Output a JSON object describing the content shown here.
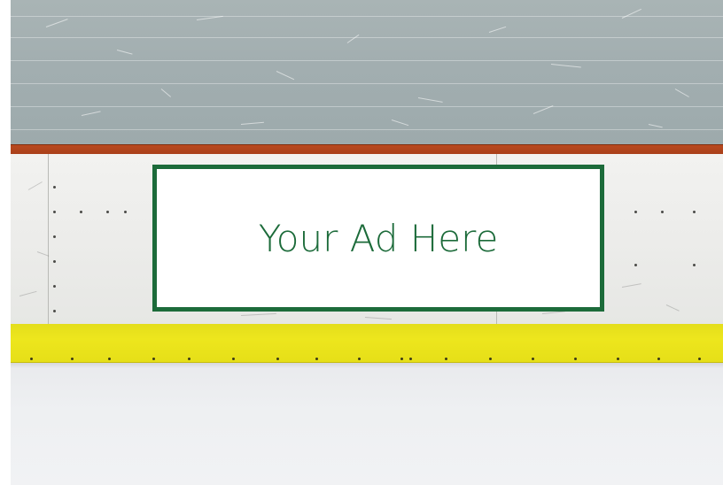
{
  "ad": {
    "text": "Your Ad Here",
    "text_color": "#1c6b3a",
    "border_color": "#1c6b3a",
    "background": "#ffffff"
  },
  "scene": {
    "glass_color": "#a2aeb0",
    "rail_color": "#b9491f",
    "boards_color": "#eeeeec",
    "kickplate_color": "#ede61d",
    "ice_color": "#eef0f2"
  }
}
